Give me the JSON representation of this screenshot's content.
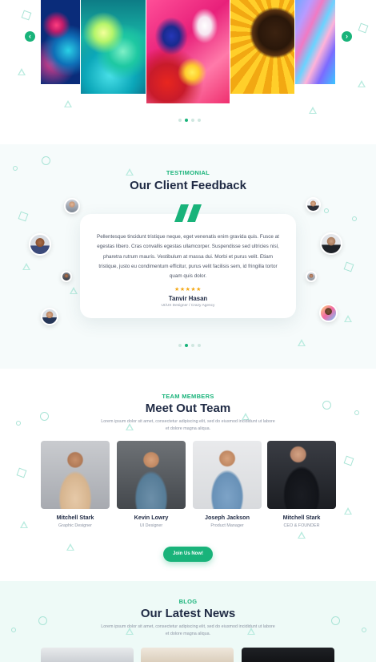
{
  "gallery": {
    "prev_icon": "chevron-left-icon",
    "next_icon": "chevron-right-icon",
    "slides": [
      {
        "name": "abstract-blue-ink"
      },
      {
        "name": "abstract-teal-smoke"
      },
      {
        "name": "abstract-pink-paint"
      },
      {
        "name": "sunflower-closeup"
      },
      {
        "name": "abstract-purple-marble"
      }
    ],
    "active_dot": 1,
    "dot_count": 4,
    "accent": "#19b37a"
  },
  "testimonial": {
    "kicker": "TESTIMONIAL",
    "title": "Our Client Feedback",
    "quote_icon": "quote-icon",
    "review": "Pellentesque tincidunt tristique neque, eget venenatis enim gravida quis. Fusce at egestas libero. Cras convallis egestas ullamcorper. Suspendisse sed ultricies nisl, pharetra rutrum mauris. Vestibulum at massa dui. Morbi et purus velit. Etiam tristique, justo eu condimentum efficitur, purus velit facilisis sem, id fringilla tortor quam quis dolor.",
    "stars": "★★★★★",
    "rating": 5,
    "reviewer_name": "Tanvir Hasan",
    "reviewer_role": "UI/UX Designer / Crazy Agency",
    "active_dot": 1,
    "dot_count": 4
  },
  "team": {
    "kicker": "TEAM MEMBERS",
    "title": "Meet Out Team",
    "subtitle": "Lorem ipsum dolor sit amet, consectetur adipiscing elit, sed do eiusmod incididunt ut labore et dolore magna aliqua.",
    "members": [
      {
        "name": "Mitchell Stark",
        "role": "Graphic Designer"
      },
      {
        "name": "Kevin Lowry",
        "role": "UI Designer"
      },
      {
        "name": "Joseph Jackson",
        "role": "Product Manager"
      },
      {
        "name": "Mitchell Stark",
        "role": "CEO & FOUNDER"
      }
    ],
    "cta_label": "Join Us Now!"
  },
  "blog": {
    "kicker": "BLOG",
    "title": "Our Latest News",
    "subtitle": "Lorem ipsum dolor sit amet, consectetur adipiscing elit, sed do eiusmod incididunt ut labore et dolore magna aliqua."
  }
}
